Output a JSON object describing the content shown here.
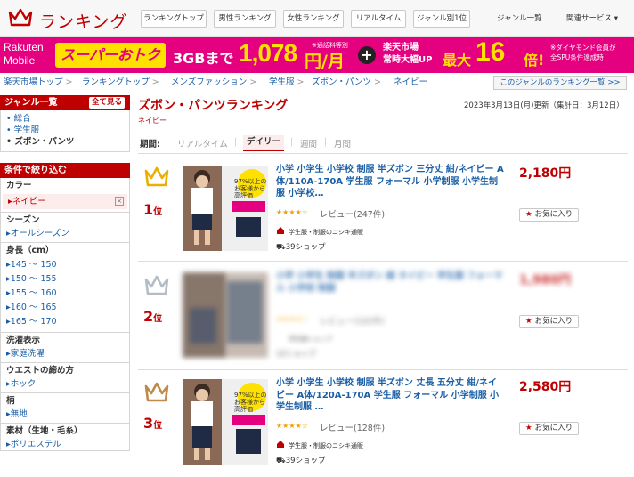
{
  "header": {
    "title": "ランキング",
    "nav": [
      "ランキングトップ",
      "男性ランキング",
      "女性ランキング",
      "リアルタイム",
      "ジャンル別1位"
    ],
    "genre_list": "ジャンル一覧",
    "related": "関連サービス ▾"
  },
  "banner": {
    "logo": [
      "Rakuten",
      "Mobile"
    ],
    "super": "スーパーおトク",
    "gb": "3GBまで",
    "price": "1,078",
    "yen": "円/月",
    "note": "※通話料等別",
    "ichiba": [
      "楽天市場",
      "常時大幅UP"
    ],
    "max": "最大",
    "times": "16",
    "bai": "倍!",
    "dia": [
      "※ダイヤモンド会員が",
      "全SPU条件達成時"
    ]
  },
  "breadcrumb": [
    "楽天市場トップ",
    "ランキングトップ",
    "メンズファッション",
    "学生服",
    "ズボン・パンツ",
    "ネイビー"
  ],
  "genre_ranking_link": "このジャンルのランキング一覧 >>",
  "sidebar": {
    "genre_title": "ジャンル一覧",
    "see_all": "全て見る",
    "genres": [
      "総合",
      "学生服",
      "ズボン・パンツ"
    ],
    "filter_title": "条件で絞り込む",
    "color": {
      "title": "カラー",
      "selected": "ネイビー"
    },
    "season": {
      "title": "シーズン",
      "items": [
        "オールシーズン"
      ]
    },
    "height": {
      "title": "身長（cm）",
      "items": [
        "145 ～ 150",
        "150 ～ 155",
        "155 ～ 160",
        "160 ～ 165",
        "165 ～ 170"
      ]
    },
    "wash": {
      "title": "洗濯表示",
      "items": [
        "家庭洗濯"
      ]
    },
    "waist": {
      "title": "ウエストの締め方",
      "items": [
        "ホック"
      ]
    },
    "pattern": {
      "title": "柄",
      "items": [
        "無地"
      ]
    },
    "material": {
      "title": "素材（生地・毛糸）",
      "items": [
        "ポリエステル"
      ]
    }
  },
  "main": {
    "title": "ズボン・パンツランキング",
    "subtitle": "ネイビー",
    "updated": "2023年3月13日(月)更新（集計日：3月12日）",
    "period_label": "期間:",
    "periods": [
      "リアルタイム",
      "デイリー",
      "週間",
      "月間"
    ],
    "items": [
      {
        "rank": "1",
        "rank_suffix": "位",
        "name": "小学 小学生 小学校 制服 半ズボン 三分丈 紺/ネイビー A体/110A-170A 学生服 フォーマル 小学制服 小学生制服 小学校…",
        "price": "2,180円",
        "stars": "★★★★☆",
        "reviews": "レビュー(247件)",
        "shop": "学生服・制服のニシキ通販",
        "shop_count": "39ショップ",
        "fav": "お気に入り",
        "badge": "97%以上のお客様から高評価"
      },
      {
        "rank": "2",
        "rank_suffix": "位",
        "name": "小学 小学生 制服 半ズボン 紺 ネイビー 学生服 フォーマル 小学校 制服",
        "price": "1,980円",
        "stars": "★★★★☆",
        "reviews": "レビュー(102件)",
        "shop": "学生服ショップ",
        "shop_count": "12ショップ",
        "fav": "お気に入り"
      },
      {
        "rank": "3",
        "rank_suffix": "位",
        "name": "小学 小学生 小学校 制服 半ズボン 丈長 五分丈 紺/ネイビー A体/120A-170A 学生服 フォーマル 小学制服 小学生制服 …",
        "price": "2,580円",
        "stars": "★★★★☆",
        "reviews": "レビュー(128件)",
        "shop": "学生服・制服のニシキ通販",
        "shop_count": "39ショップ",
        "fav": "お気に入り",
        "badge": "97%以上のお客様から高評価"
      }
    ]
  }
}
